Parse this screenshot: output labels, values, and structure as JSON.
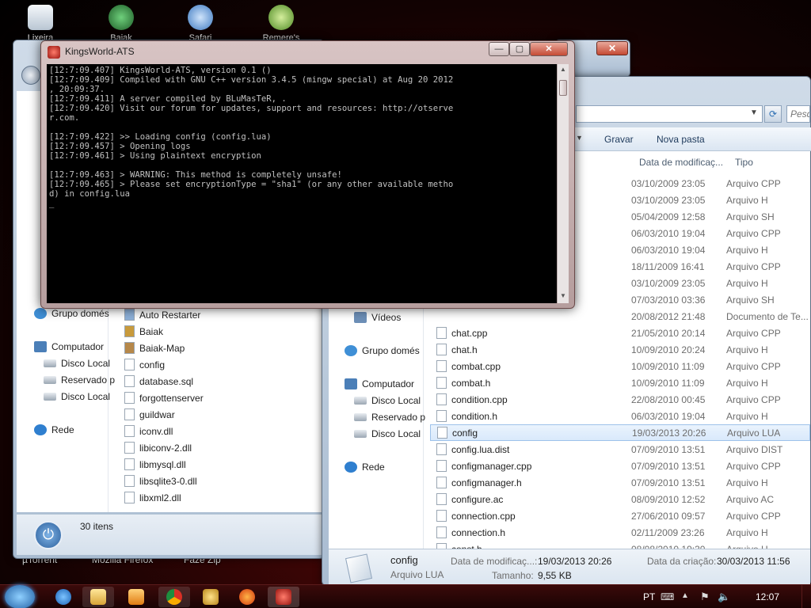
{
  "desktop": {
    "icons": [
      {
        "label": "Lixeira",
        "color": "#dfe6ee"
      },
      {
        "label": "Baiak",
        "color": "#2f7d3a"
      },
      {
        "label": "Safari",
        "color": "#4a88d0"
      },
      {
        "label": "Remere's Map",
        "color": "#7db84a"
      }
    ],
    "bottom_labels": [
      "µTorrent",
      "Mozilla Firefox",
      "Faze Zip"
    ]
  },
  "console_window": {
    "title": "KingsWorld-ATS",
    "lines": [
      "[12:7:09.407] KingsWorld-ATS, version 0.1 ()",
      "[12:7:09.409] Compiled with GNU C++ version 3.4.5 (mingw special) at Aug 20 2012",
      ", 20:09:37.",
      "[12:7:09.411] A server compiled by BLuMasTeR, .",
      "[12:7:09.420] Visit our forum for updates, support and resources: http://otserve",
      "r.com.",
      "",
      "[12:7:09.422] >> Loading config (config.lua)",
      "[12:7:09.457] > Opening logs",
      "[12:7:09.461] > Using plaintext encryption",
      "",
      "[12:7:09.463] > WARNING: This method is completely unsafe!",
      "[12:7:09.465] > Please set encryptionType = \"sha1\" (or any other available metho",
      "d) in config.lua",
      "_"
    ]
  },
  "left_explorer": {
    "nav": [
      {
        "label": "Grupo domés",
        "icon": "homegroup-icon"
      },
      {
        "label": "Computador",
        "icon": "computer-icon"
      },
      {
        "label": "Disco Local",
        "icon": "drive-icon"
      },
      {
        "label": "Reservado p",
        "icon": "drive-icon"
      },
      {
        "label": "Disco Local",
        "icon": "drive-icon"
      },
      {
        "label": "Rede",
        "icon": "network-icon"
      }
    ],
    "files": [
      "Auto Restarter",
      "Baiak",
      "Baiak-Map",
      "config",
      "database.sql",
      "forgottenserver",
      "guildwar",
      "iconv.dll",
      "libiconv-2.dll",
      "libmysql.dll",
      "libsqlite3-0.dll",
      "libxml2.dll"
    ],
    "status": "30 itens"
  },
  "right_explorer": {
    "search_placeholder": "Pesq",
    "toolbar": {
      "burn": "Gravar",
      "new_folder": "Nova pasta"
    },
    "columns": {
      "date": "Data de modificaç...",
      "type": "Tipo"
    },
    "nav": [
      {
        "label": "Vídeos"
      },
      {
        "label": "Grupo domés"
      },
      {
        "label": "Computador"
      },
      {
        "label": "Disco Local"
      },
      {
        "label": "Reservado p"
      },
      {
        "label": "Disco Local"
      },
      {
        "label": "Rede"
      }
    ],
    "rows": [
      {
        "name": "",
        "date": "03/10/2009 23:05",
        "type": "Arquivo CPP"
      },
      {
        "name": "",
        "date": "03/10/2009 23:05",
        "type": "Arquivo H"
      },
      {
        "name": "",
        "date": "05/04/2009 12:58",
        "type": "Arquivo SH"
      },
      {
        "name": "",
        "date": "06/03/2010 19:04",
        "type": "Arquivo CPP"
      },
      {
        "name": "",
        "date": "06/03/2010 19:04",
        "type": "Arquivo H"
      },
      {
        "name": "",
        "date": "18/11/2009 16:41",
        "type": "Arquivo CPP"
      },
      {
        "name": "",
        "date": "03/10/2009 23:05",
        "type": "Arquivo H"
      },
      {
        "name": "",
        "date": "07/03/2010 03:36",
        "type": "Arquivo SH"
      },
      {
        "name": "",
        "date": "20/08/2012 21:48",
        "type": "Documento de Te..."
      },
      {
        "name": "chat.cpp",
        "date": "21/05/2010 20:14",
        "type": "Arquivo CPP"
      },
      {
        "name": "chat.h",
        "date": "10/09/2010 20:24",
        "type": "Arquivo H"
      },
      {
        "name": "combat.cpp",
        "date": "10/09/2010 11:09",
        "type": "Arquivo CPP"
      },
      {
        "name": "combat.h",
        "date": "10/09/2010 11:09",
        "type": "Arquivo H"
      },
      {
        "name": "condition.cpp",
        "date": "22/08/2010 00:45",
        "type": "Arquivo CPP"
      },
      {
        "name": "condition.h",
        "date": "06/03/2010 19:04",
        "type": "Arquivo H"
      },
      {
        "name": "config",
        "date": "19/03/2013 20:26",
        "type": "Arquivo LUA"
      },
      {
        "name": "config.lua.dist",
        "date": "07/09/2010 13:51",
        "type": "Arquivo DIST"
      },
      {
        "name": "configmanager.cpp",
        "date": "07/09/2010 13:51",
        "type": "Arquivo CPP"
      },
      {
        "name": "configmanager.h",
        "date": "07/09/2010 13:51",
        "type": "Arquivo H"
      },
      {
        "name": "configure.ac",
        "date": "08/09/2010 12:52",
        "type": "Arquivo AC"
      },
      {
        "name": "connection.cpp",
        "date": "27/06/2010 09:57",
        "type": "Arquivo CPP"
      },
      {
        "name": "connection.h",
        "date": "02/11/2009 23:26",
        "type": "Arquivo H"
      },
      {
        "name": "const.h",
        "date": "08/08/2010 19:30",
        "type": "Arquivo H"
      }
    ],
    "details": {
      "name": "config",
      "type": "Arquivo LUA",
      "modified_label": "Data de modificaç...:",
      "modified_value": "19/03/2013 20:26",
      "created_label": "Data da criação:",
      "created_value": "30/03/2013 11:56",
      "size_label": "Tamanho:",
      "size_value": "9,55 KB"
    }
  },
  "taskbar": {
    "language": "PT",
    "clock": "12:07",
    "apps": [
      "internet-explorer-icon",
      "explorer-icon",
      "media-player-icon",
      "chrome-icon",
      "kingsworld-icon",
      "firefox-icon",
      "console-icon"
    ]
  },
  "colors": {
    "accent": "#3b6fb6",
    "taskbar": "#2a0505",
    "console_bg": "#000000"
  }
}
